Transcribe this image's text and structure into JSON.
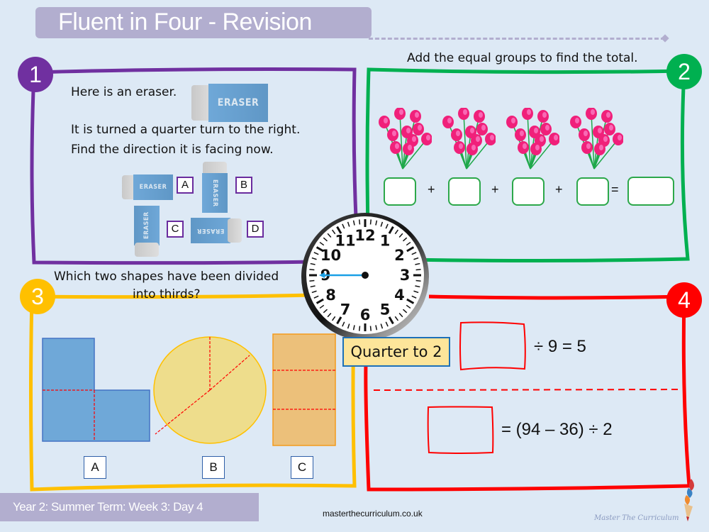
{
  "header": {
    "title": "Fluent in Four - Revision"
  },
  "footer": {
    "lesson": "Year 2: Summer Term: Week 3: Day 4",
    "website": "masterthecurriculum.co.uk",
    "brand": "Master The Curriculum"
  },
  "colors": {
    "q1": "#7030a0",
    "q2": "#00b050",
    "q3": "#ffc000",
    "q4": "#ff0000",
    "title_bar": "#b2aecf",
    "background": "#dde9f5"
  },
  "question1": {
    "number": "1",
    "line1": "Here is an eraser.",
    "line2": "It is turned a quarter turn to the right.",
    "line3": "Find the direction it is facing now.",
    "eraser_label": "ERASER",
    "options": [
      "A",
      "B",
      "C",
      "D"
    ]
  },
  "question2": {
    "number": "2",
    "prompt": "Add the equal groups to find the total.",
    "groups": 4,
    "operators": [
      "+",
      "+",
      "+",
      "="
    ]
  },
  "question3": {
    "number": "3",
    "prompt_line1": "Which two shapes have been divided",
    "prompt_line2": "into thirds?",
    "shape_labels": [
      "A",
      "B",
      "C"
    ]
  },
  "question4": {
    "number": "4",
    "equation1": "÷ 9 = 5",
    "equation2": "= (94 – 36) ÷ 2"
  },
  "clock": {
    "numbers": [
      "12",
      "1",
      "2",
      "3",
      "4",
      "5",
      "6",
      "7",
      "8",
      "9",
      "10",
      "11"
    ],
    "hour": 1,
    "minute": 45,
    "label": "Quarter to 2"
  }
}
